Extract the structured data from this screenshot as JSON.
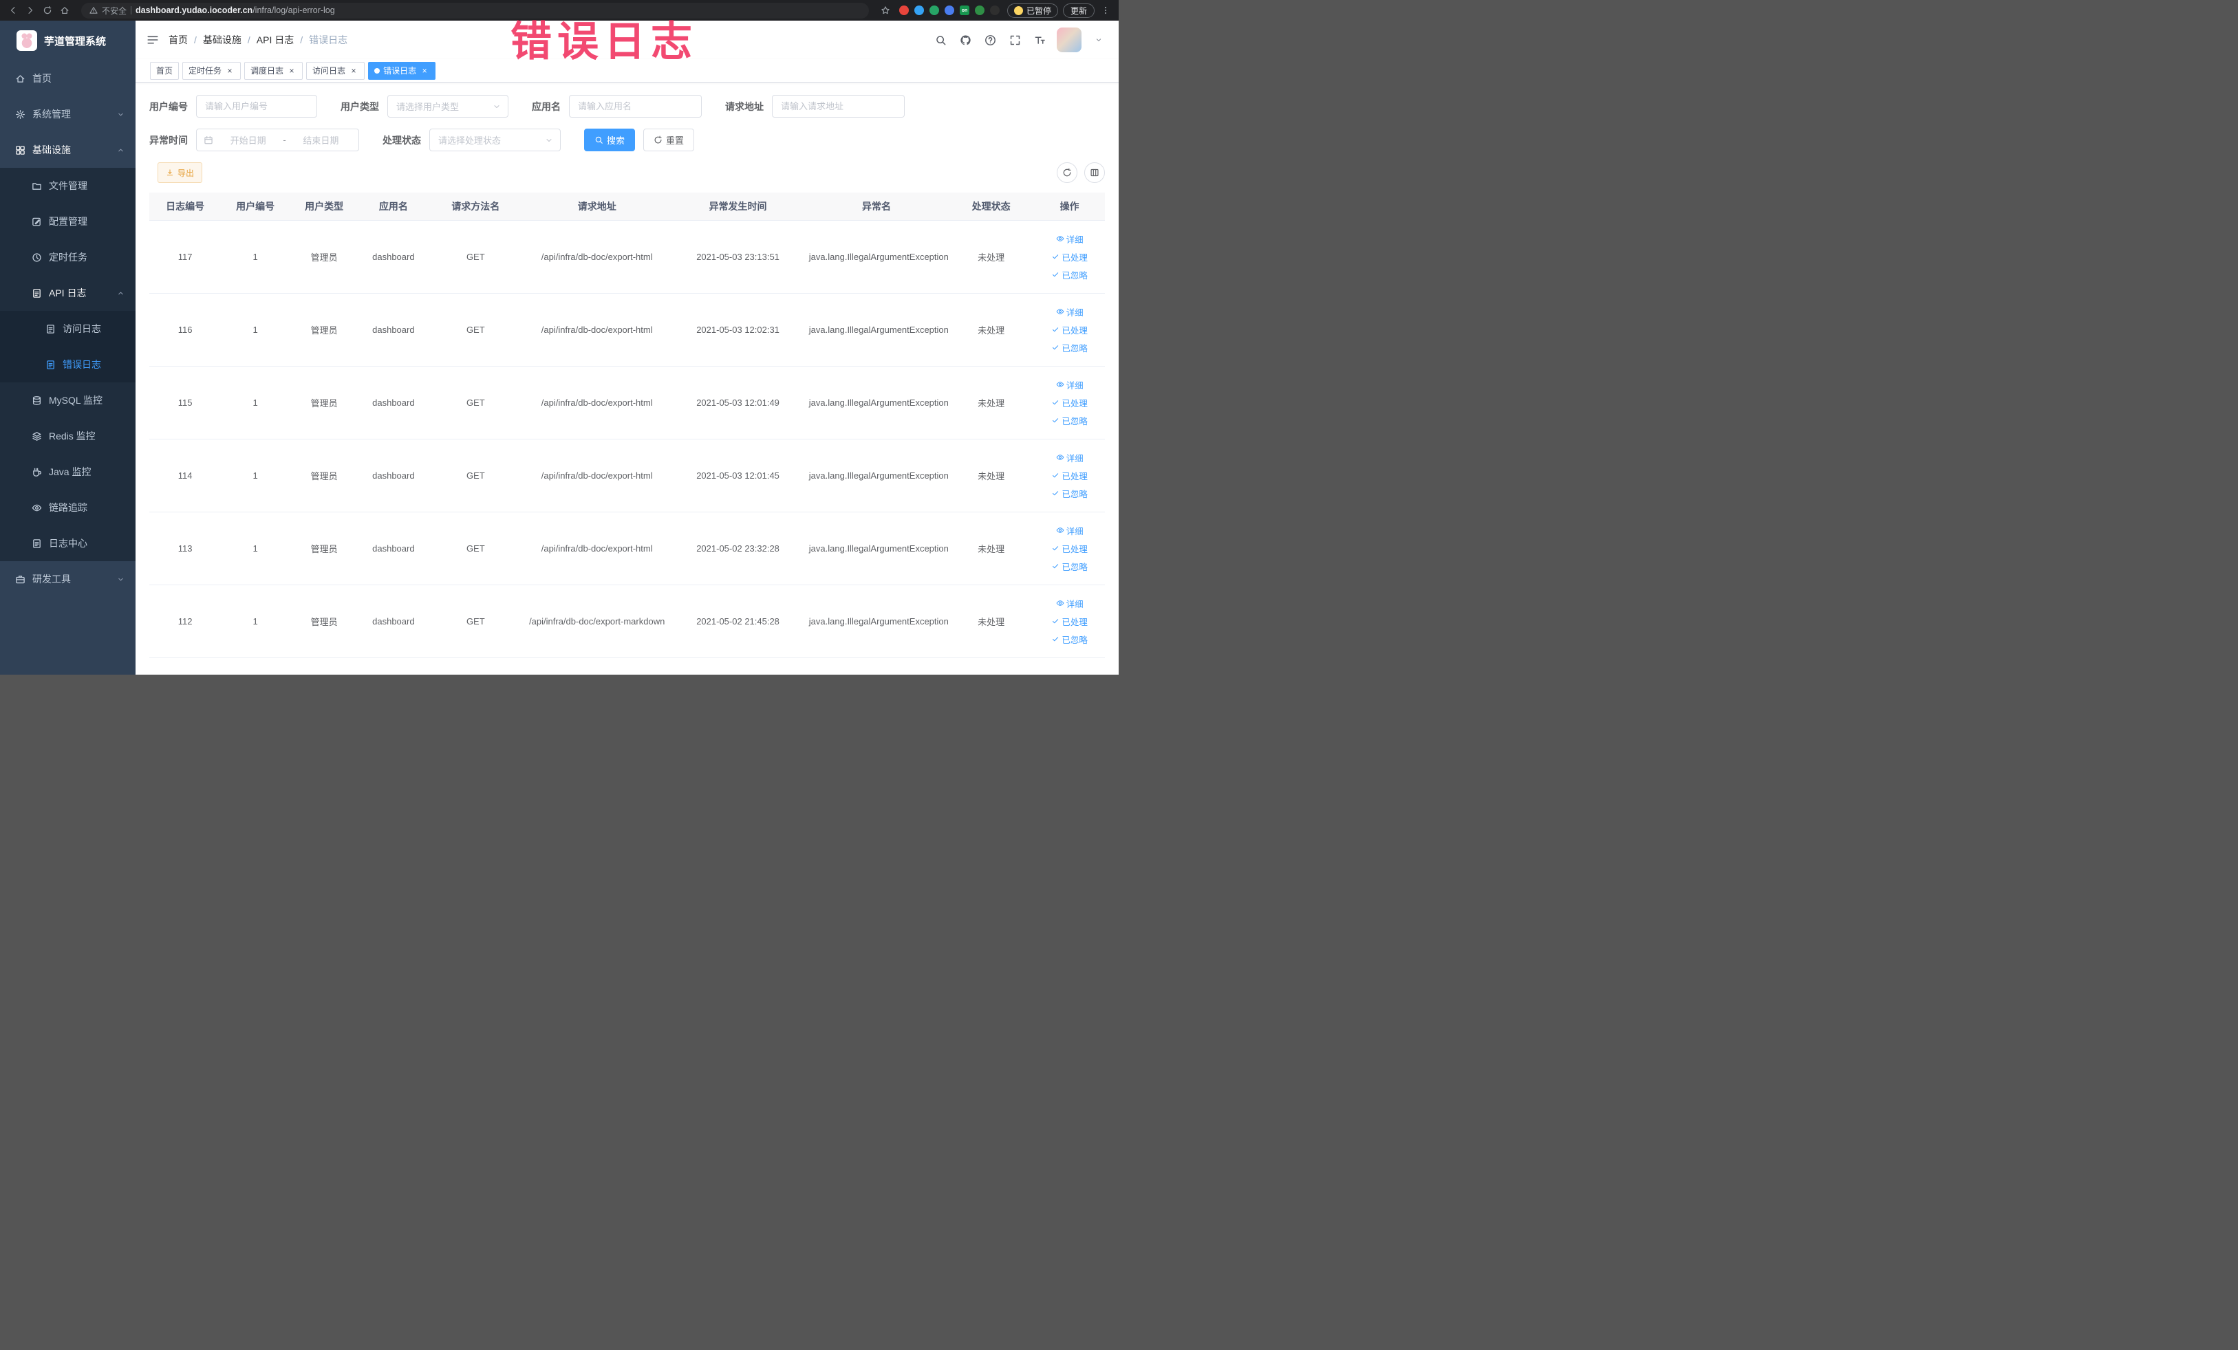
{
  "annotation": {
    "text": "错误日志"
  },
  "browser": {
    "security_label": "不安全",
    "url_domain": "dashboard.yudao.iocoder.cn",
    "url_path": "/infra/log/api-error-log",
    "paused_label": "已暂停",
    "update_label": "更新",
    "extensions": [
      {
        "name": "extension-red-circle",
        "color": "#e8453c"
      },
      {
        "name": "extension-blue-drop",
        "color": "#35a3f5"
      },
      {
        "name": "extension-green-circle",
        "color": "#27a567"
      },
      {
        "name": "extension-blue-grid",
        "color": "#4a7df0"
      },
      {
        "name": "extension-on-badge",
        "color": "#17964f",
        "text": "on"
      },
      {
        "name": "extension-leaf",
        "color": "#2f8f46"
      },
      {
        "name": "extension-paw",
        "color": "#2f2f2f"
      }
    ]
  },
  "sidebar": {
    "title": "芋道管理系统",
    "menu": [
      {
        "label": "首页",
        "icon": "home-icon"
      },
      {
        "label": "系统管理",
        "icon": "gear-icon",
        "arrow": "down"
      },
      {
        "label": "基础设施",
        "icon": "grid-icon",
        "arrow": "up",
        "open": true,
        "children": [
          {
            "label": "文件管理",
            "icon": "folder-icon"
          },
          {
            "label": "配置管理",
            "icon": "edit-icon"
          },
          {
            "label": "定时任务",
            "icon": "clock-icon"
          },
          {
            "label": "API 日志",
            "icon": "doc-icon",
            "arrow": "up",
            "open": true,
            "children": [
              {
                "label": "访问日志",
                "icon": "doc-icon"
              },
              {
                "label": "错误日志",
                "icon": "doc-icon",
                "active": true
              }
            ]
          },
          {
            "label": "MySQL 监控",
            "icon": "database-icon"
          },
          {
            "label": "Redis 监控",
            "icon": "layers-icon"
          },
          {
            "label": "Java 监控",
            "icon": "coffee-icon"
          },
          {
            "label": "链路追踪",
            "icon": "eye-icon"
          },
          {
            "label": "日志中心",
            "icon": "doc-icon"
          }
        ]
      },
      {
        "label": "研发工具",
        "icon": "briefcase-icon",
        "arrow": "down"
      }
    ]
  },
  "header": {
    "breadcrumb": [
      "首页",
      "基础设施",
      "API 日志",
      "错误日志"
    ]
  },
  "tabs": [
    {
      "label": "首页",
      "closable": false,
      "active": false
    },
    {
      "label": "定时任务",
      "closable": true,
      "active": false
    },
    {
      "label": "调度日志",
      "closable": true,
      "active": false
    },
    {
      "label": "访问日志",
      "closable": true,
      "active": false
    },
    {
      "label": "错误日志",
      "closable": true,
      "active": true
    }
  ],
  "filters": {
    "fields": [
      {
        "label": "用户编号",
        "placeholder": "请输入用户编号"
      },
      {
        "label": "用户类型",
        "placeholder": "请选择用户类型"
      },
      {
        "label": "应用名",
        "placeholder": "请输入应用名"
      },
      {
        "label": "请求地址",
        "placeholder": "请输入请求地址"
      },
      {
        "label": "异常时间",
        "start_placeholder": "开始日期",
        "end_placeholder": "结束日期",
        "range_separator": "-"
      },
      {
        "label": "处理状态",
        "placeholder": "请选择处理状态"
      }
    ],
    "search_label": "搜索",
    "reset_label": "重置"
  },
  "toolbar": {
    "export_label": "导出"
  },
  "table": {
    "columns": [
      "日志编号",
      "用户编号",
      "用户类型",
      "应用名",
      "请求方法名",
      "请求地址",
      "异常发生时间",
      "异常名",
      "处理状态",
      "操作"
    ],
    "rows": [
      [
        "117",
        "1",
        "管理员",
        "dashboard",
        "GET",
        "/api/infra/db-doc/export-html",
        "2021-05-03 23:13:51",
        "java.lang.IllegalArgumentException",
        "未处理"
      ],
      [
        "116",
        "1",
        "管理员",
        "dashboard",
        "GET",
        "/api/infra/db-doc/export-html",
        "2021-05-03 12:02:31",
        "java.lang.IllegalArgumentException",
        "未处理"
      ],
      [
        "115",
        "1",
        "管理员",
        "dashboard",
        "GET",
        "/api/infra/db-doc/export-html",
        "2021-05-03 12:01:49",
        "java.lang.IllegalArgumentException",
        "未处理"
      ],
      [
        "114",
        "1",
        "管理员",
        "dashboard",
        "GET",
        "/api/infra/db-doc/export-html",
        "2021-05-03 12:01:45",
        "java.lang.IllegalArgumentException",
        "未处理"
      ],
      [
        "113",
        "1",
        "管理员",
        "dashboard",
        "GET",
        "/api/infra/db-doc/export-html",
        "2021-05-02 23:32:28",
        "java.lang.IllegalArgumentException",
        "未处理"
      ],
      [
        "112",
        "1",
        "管理员",
        "dashboard",
        "GET",
        "/api/infra/db-doc/export-markdown",
        "2021-05-02 21:45:28",
        "java.lang.IllegalArgumentException",
        "未处理"
      ]
    ],
    "row_actions": [
      {
        "label": "详细",
        "icon": "eye-icon",
        "name": "detail-link"
      },
      {
        "label": "已处理",
        "icon": "check-icon",
        "name": "processed-link"
      },
      {
        "label": "已忽略",
        "icon": "check-icon",
        "name": "ignored-link"
      }
    ]
  }
}
